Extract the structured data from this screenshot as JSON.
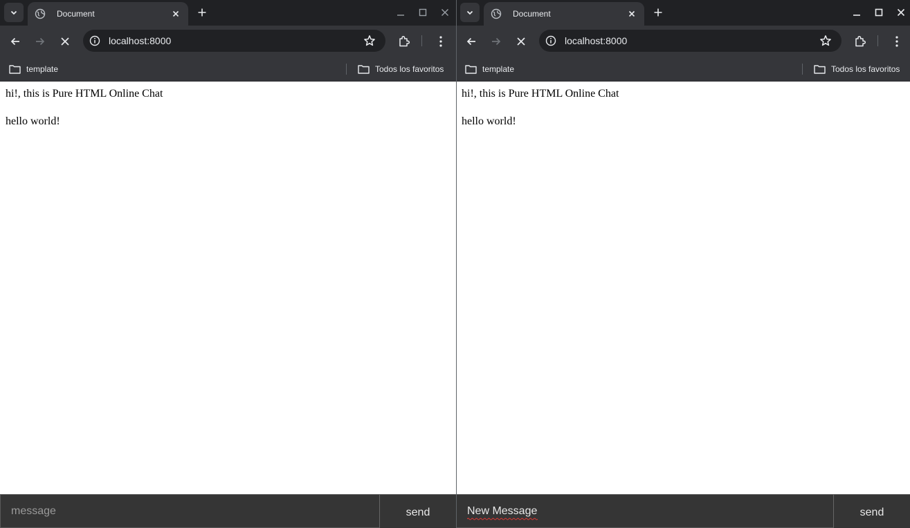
{
  "windows": [
    {
      "id": "left",
      "tab": {
        "title": "Document"
      },
      "address": {
        "url": "localhost:8000"
      },
      "bookmarks": {
        "folder": "template",
        "all_bookmarks": "Todos los favoritos"
      },
      "chat": {
        "messages": [
          "hi!, this is Pure HTML Online Chat",
          "hello world!"
        ]
      },
      "composer": {
        "value": "",
        "placeholder": "message",
        "send_label": "send"
      }
    },
    {
      "id": "right",
      "tab": {
        "title": "Document"
      },
      "address": {
        "url": "localhost:8000"
      },
      "bookmarks": {
        "folder": "template",
        "all_bookmarks": "Todos los favoritos"
      },
      "chat": {
        "messages": [
          "hi!, this is Pure HTML Online Chat",
          "hello world!"
        ]
      },
      "composer": {
        "value": "New Message",
        "placeholder": "message",
        "send_label": "send"
      }
    }
  ],
  "colors": {
    "tabstrip": "#202124",
    "toolbar": "#35363a",
    "text": "#e8eaed",
    "composer": "#353535"
  },
  "icons": [
    "tab-search-icon",
    "globe-icon",
    "close-icon",
    "plus-icon",
    "minimize-icon",
    "maximize-icon",
    "back-icon",
    "forward-icon",
    "stop-icon",
    "site-info-icon",
    "star-icon",
    "extensions-icon",
    "menu-icon",
    "folder-icon"
  ]
}
